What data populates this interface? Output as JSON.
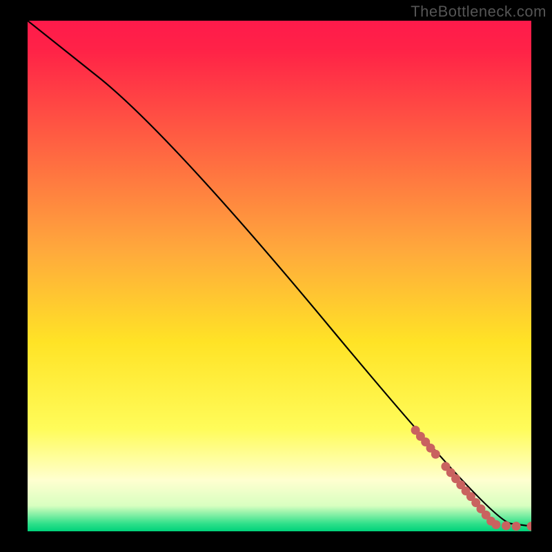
{
  "watermark": "TheBottleneck.com",
  "chart_data": {
    "type": "line",
    "title": "",
    "xlabel": "",
    "ylabel": "",
    "xlim": [
      0,
      100
    ],
    "ylim": [
      0,
      100
    ],
    "curve": [
      {
        "x": 0,
        "y": 100
      },
      {
        "x": 28,
        "y": 78
      },
      {
        "x": 92,
        "y": 2
      },
      {
        "x": 100,
        "y": 1
      }
    ],
    "markers": [
      {
        "x": 77,
        "y": 19.8
      },
      {
        "x": 78,
        "y": 18.6
      },
      {
        "x": 79,
        "y": 17.5
      },
      {
        "x": 80,
        "y": 16.3
      },
      {
        "x": 81,
        "y": 15.1
      },
      {
        "x": 83,
        "y": 12.7
      },
      {
        "x": 84,
        "y": 11.5
      },
      {
        "x": 85,
        "y": 10.3
      },
      {
        "x": 86,
        "y": 9.1
      },
      {
        "x": 87,
        "y": 7.9
      },
      {
        "x": 88,
        "y": 6.8
      },
      {
        "x": 89,
        "y": 5.6
      },
      {
        "x": 90,
        "y": 4.4
      },
      {
        "x": 91,
        "y": 3.2
      },
      {
        "x": 92,
        "y": 2.0
      },
      {
        "x": 93,
        "y": 1.3
      },
      {
        "x": 95,
        "y": 1.1
      },
      {
        "x": 97,
        "y": 1.0
      },
      {
        "x": 100,
        "y": 1.0
      }
    ],
    "gradient_stops": [
      {
        "offset": 0.0,
        "color": "#ff1a4b"
      },
      {
        "offset": 0.06,
        "color": "#ff2347"
      },
      {
        "offset": 0.45,
        "color": "#ffa93c"
      },
      {
        "offset": 0.63,
        "color": "#ffe326"
      },
      {
        "offset": 0.8,
        "color": "#fffc5a"
      },
      {
        "offset": 0.9,
        "color": "#ffffd0"
      },
      {
        "offset": 0.95,
        "color": "#d8ffc0"
      },
      {
        "offset": 0.985,
        "color": "#2fe08a"
      },
      {
        "offset": 1.0,
        "color": "#00d27a"
      }
    ],
    "marker_color": "#c9625f",
    "line_color": "#000000"
  }
}
